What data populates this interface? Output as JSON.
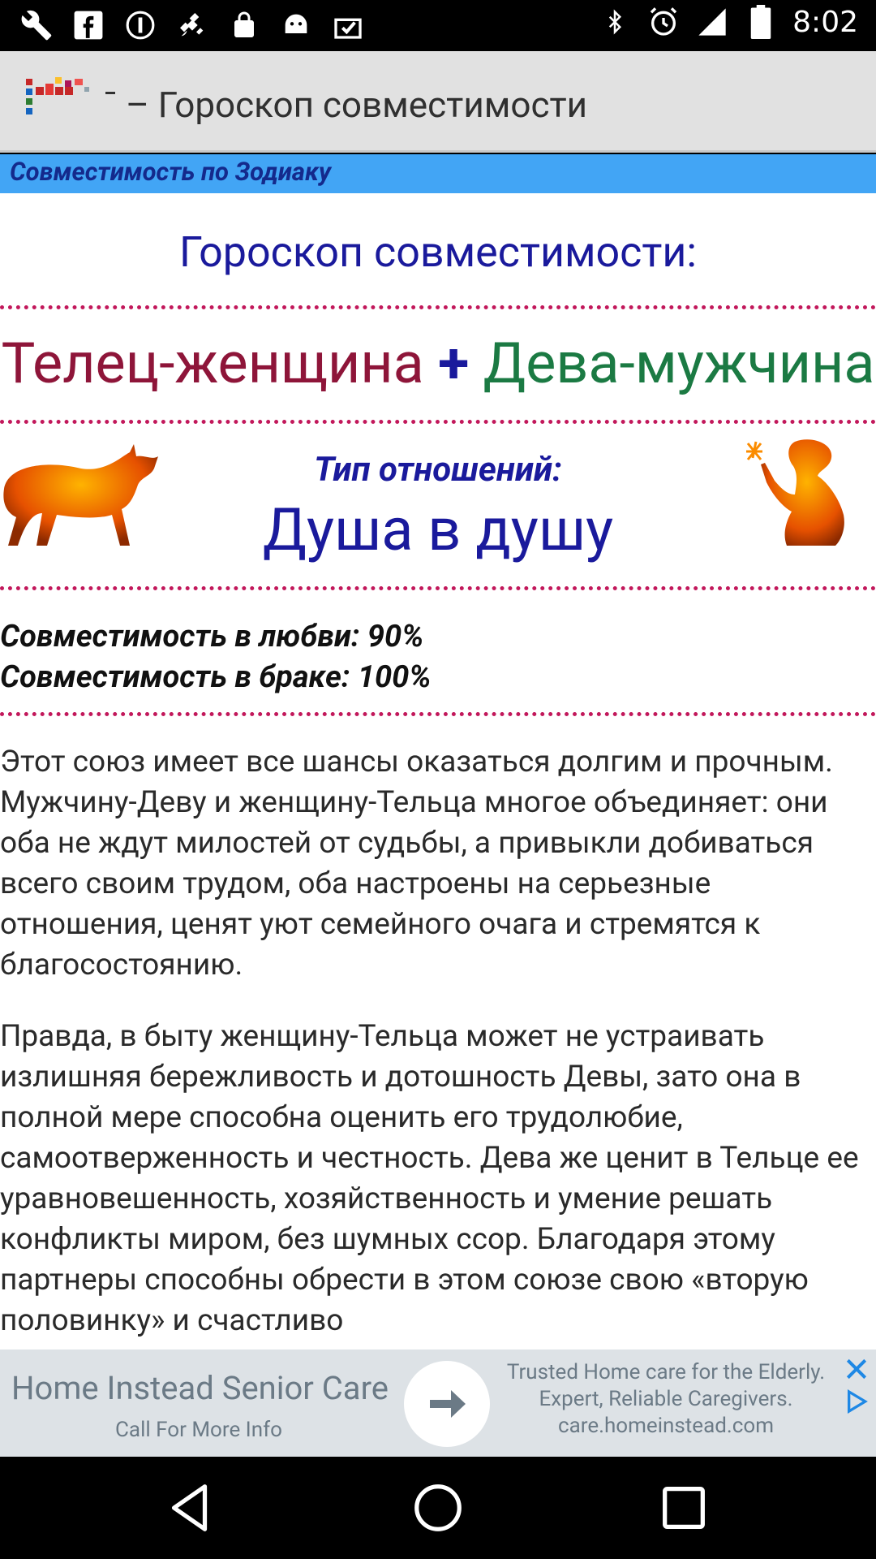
{
  "status_bar": {
    "time": "8:02",
    "left_icons": [
      "wrench-icon",
      "facebook-icon",
      "info-icon",
      "satellite-icon",
      "lock-icon",
      "android-icon",
      "clipboard-check-icon"
    ],
    "right_icons": [
      "bluetooth-icon",
      "alarm-icon",
      "signal-icon",
      "battery-icon"
    ]
  },
  "toolbar": {
    "title": "– Гороскоп совместимости"
  },
  "band": {
    "label": "Совместимость по Зодиаку"
  },
  "main": {
    "heading": "Гороскоп совместимости:",
    "woman": "Телец-женщина",
    "plus": "+",
    "man": "Дева-мужчина",
    "relation_label": "Тип отношений:",
    "relation_value": "Душа в душу",
    "love": "Совместимость в любви: 90%",
    "marriage": "Совместимость в браке: 100%",
    "paragraph1": "Этот союз имеет все шансы оказаться долгим и прочным. Мужчину-Деву и женщину-Тельца многое объединяет: они оба не ждут милостей от судьбы, а привыкли добиваться всего своим трудом, оба настроены на серьезные отношения, ценят уют семейного очага и стремятся к благосостоянию.",
    "paragraph2": "Правда, в быту женщину-Тельца может не устраивать излишняя бережливость и дотошность Девы, зато она в полной мере способна оценить его трудолюбие, самоотверженность и честность. Дева же ценит в Тельце ее уравновешенность, хозяйственность и умение решать конфликты миром, без шумных ссор. Благодаря этому партнеры способны обрести в этом союзе свою «вторую половинку» и счастливо"
  },
  "ad": {
    "title": "Home Instead Senior Care",
    "cta": "Call For More Info",
    "desc_line1": "Trusted Home care for the Elderly.",
    "desc_line2": "Expert, Reliable Caregivers.",
    "url": "care.homeinstead.com"
  },
  "nav": {
    "buttons": [
      "back-icon",
      "home-icon",
      "recents-icon"
    ]
  },
  "colors": {
    "band": "#42a5f5",
    "heading": "#1a1a9c",
    "woman": "#8e1539",
    "man": "#1b7a43",
    "divider": "#c2185b"
  }
}
